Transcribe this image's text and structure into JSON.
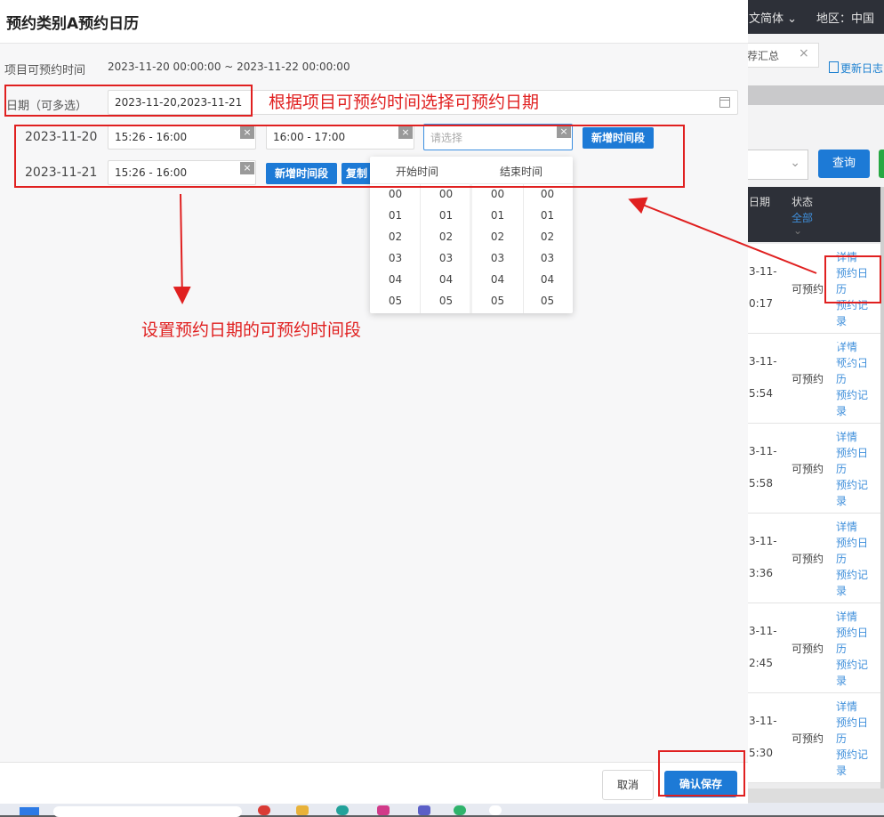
{
  "modal": {
    "title": "预约类别A预约日历",
    "project_time_label": "项目可预约时间",
    "project_time_value": "2023-11-20 00:00:00 ~ 2023-11-22 00:00:00",
    "date_label": "日期（可多选）",
    "date_value": "2023-11-20,2023-11-21",
    "rows": [
      {
        "date": "2023-11-20",
        "slots": [
          "15:26 - 16:00",
          "16:00 - 17:00"
        ],
        "placeholder": "请选择",
        "add_label": "新增时间段"
      },
      {
        "date": "2023-11-21",
        "slots": [
          "15:26 - 16:00"
        ],
        "add_label": "新增时间段",
        "copy_label": "复制"
      }
    ],
    "clear_icon": "×",
    "picker": {
      "start_header": "开始时间",
      "end_header": "结束时间",
      "hours": [
        "00",
        "01",
        "02",
        "03",
        "04",
        "05"
      ]
    },
    "cancel_label": "取消",
    "save_label": "确认保存"
  },
  "annotations": {
    "date_note": "根据项目可预约时间选择可预约日期",
    "slot_note": "设置预约日期的可预约时间段"
  },
  "background": {
    "lang": "文简体 ⌄",
    "region": "地区：中国",
    "tab": "荐汇总",
    "tab_close": "×",
    "log": "更新日志",
    "query": "查询",
    "col_date": "日期",
    "col_status": "状态",
    "status_filter": "全部",
    "status_filter_chev": "⌄",
    "select_chev": "⌄",
    "rows": [
      {
        "d1": "3-11-",
        "d2": "0:17",
        "status": "可预约",
        "links": [
          "详情",
          "预约日历",
          "预约记录"
        ]
      },
      {
        "d1": "3-11-",
        "d2": "5:54",
        "status": "可预约",
        "links": [
          "详情",
          "预约日历",
          "预约记录"
        ]
      },
      {
        "d1": "3-11-",
        "d2": "5:58",
        "status": "可预约",
        "links": [
          "详情",
          "预约日历",
          "预约记录"
        ]
      },
      {
        "d1": "3-11-",
        "d2": "3:36",
        "status": "可预约",
        "links": [
          "详情",
          "预约日历",
          "预约记录"
        ]
      },
      {
        "d1": "3-11-",
        "d2": "2:45",
        "status": "可预约",
        "links": [
          "详情",
          "预约日历",
          "预约记录"
        ]
      },
      {
        "d1": "3-11-",
        "d2": "5:30",
        "status": "可预约",
        "links": [
          "详情",
          "预约日历",
          "预约记录"
        ]
      }
    ]
  },
  "colors": {
    "primary": "#1d7ad6",
    "annotation": "#e02020",
    "link": "#3f8fdb",
    "header_dark": "#2d3038"
  }
}
